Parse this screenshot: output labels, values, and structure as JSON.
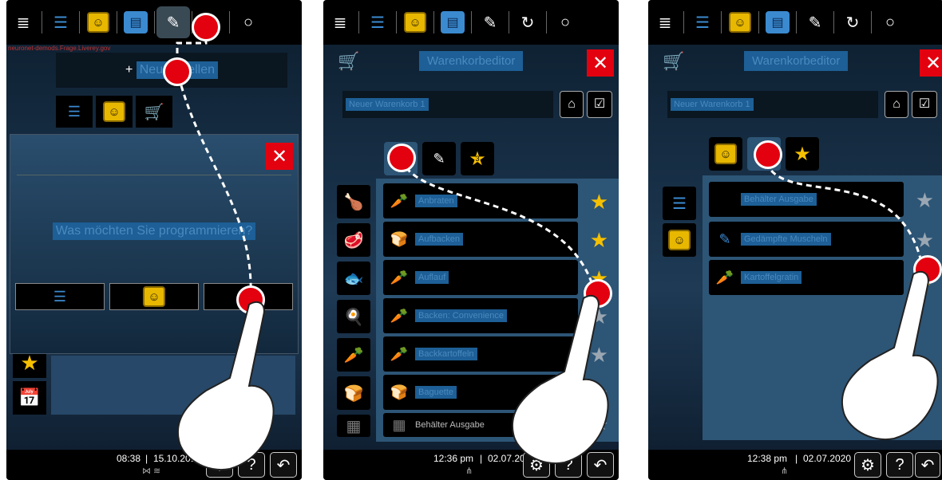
{
  "colors": {
    "accent_red": "#e3000f",
    "highlight_blue": "#1d5f96",
    "star_yellow": "#f6c000"
  },
  "topbar": {
    "menu_icon": "hamburger-icon",
    "search_icon": "search-icon"
  },
  "screen1": {
    "url_text": "neuronet-demods.Frage.Liverey.gov",
    "new_button": "Neu erstellen",
    "dialog_question": "Was möchten Sie programmieren?",
    "time": "08:38",
    "date": "15.10.2019"
  },
  "screen2": {
    "title": "Warenkorbeditor",
    "basket_name": "Neuer Warenkorb 1",
    "favorites_count": "3",
    "items": [
      "Anbraten",
      "Aufbacken",
      "Auflauf",
      "Backen: Convenience",
      "Backkartoffeln",
      "Baguette",
      "Behälter Ausgabe"
    ],
    "time": "12:36 pm",
    "date": "02.07.2020"
  },
  "screen3": {
    "title": "Warenkorbeditor",
    "basket_name": "Neuer Warenkorb 1",
    "items": [
      "Behälter Ausgabe",
      "Gedämpfte Muscheln",
      "Kartoffelgratin"
    ],
    "time": "12:38 pm",
    "date": "02.07.2020"
  }
}
